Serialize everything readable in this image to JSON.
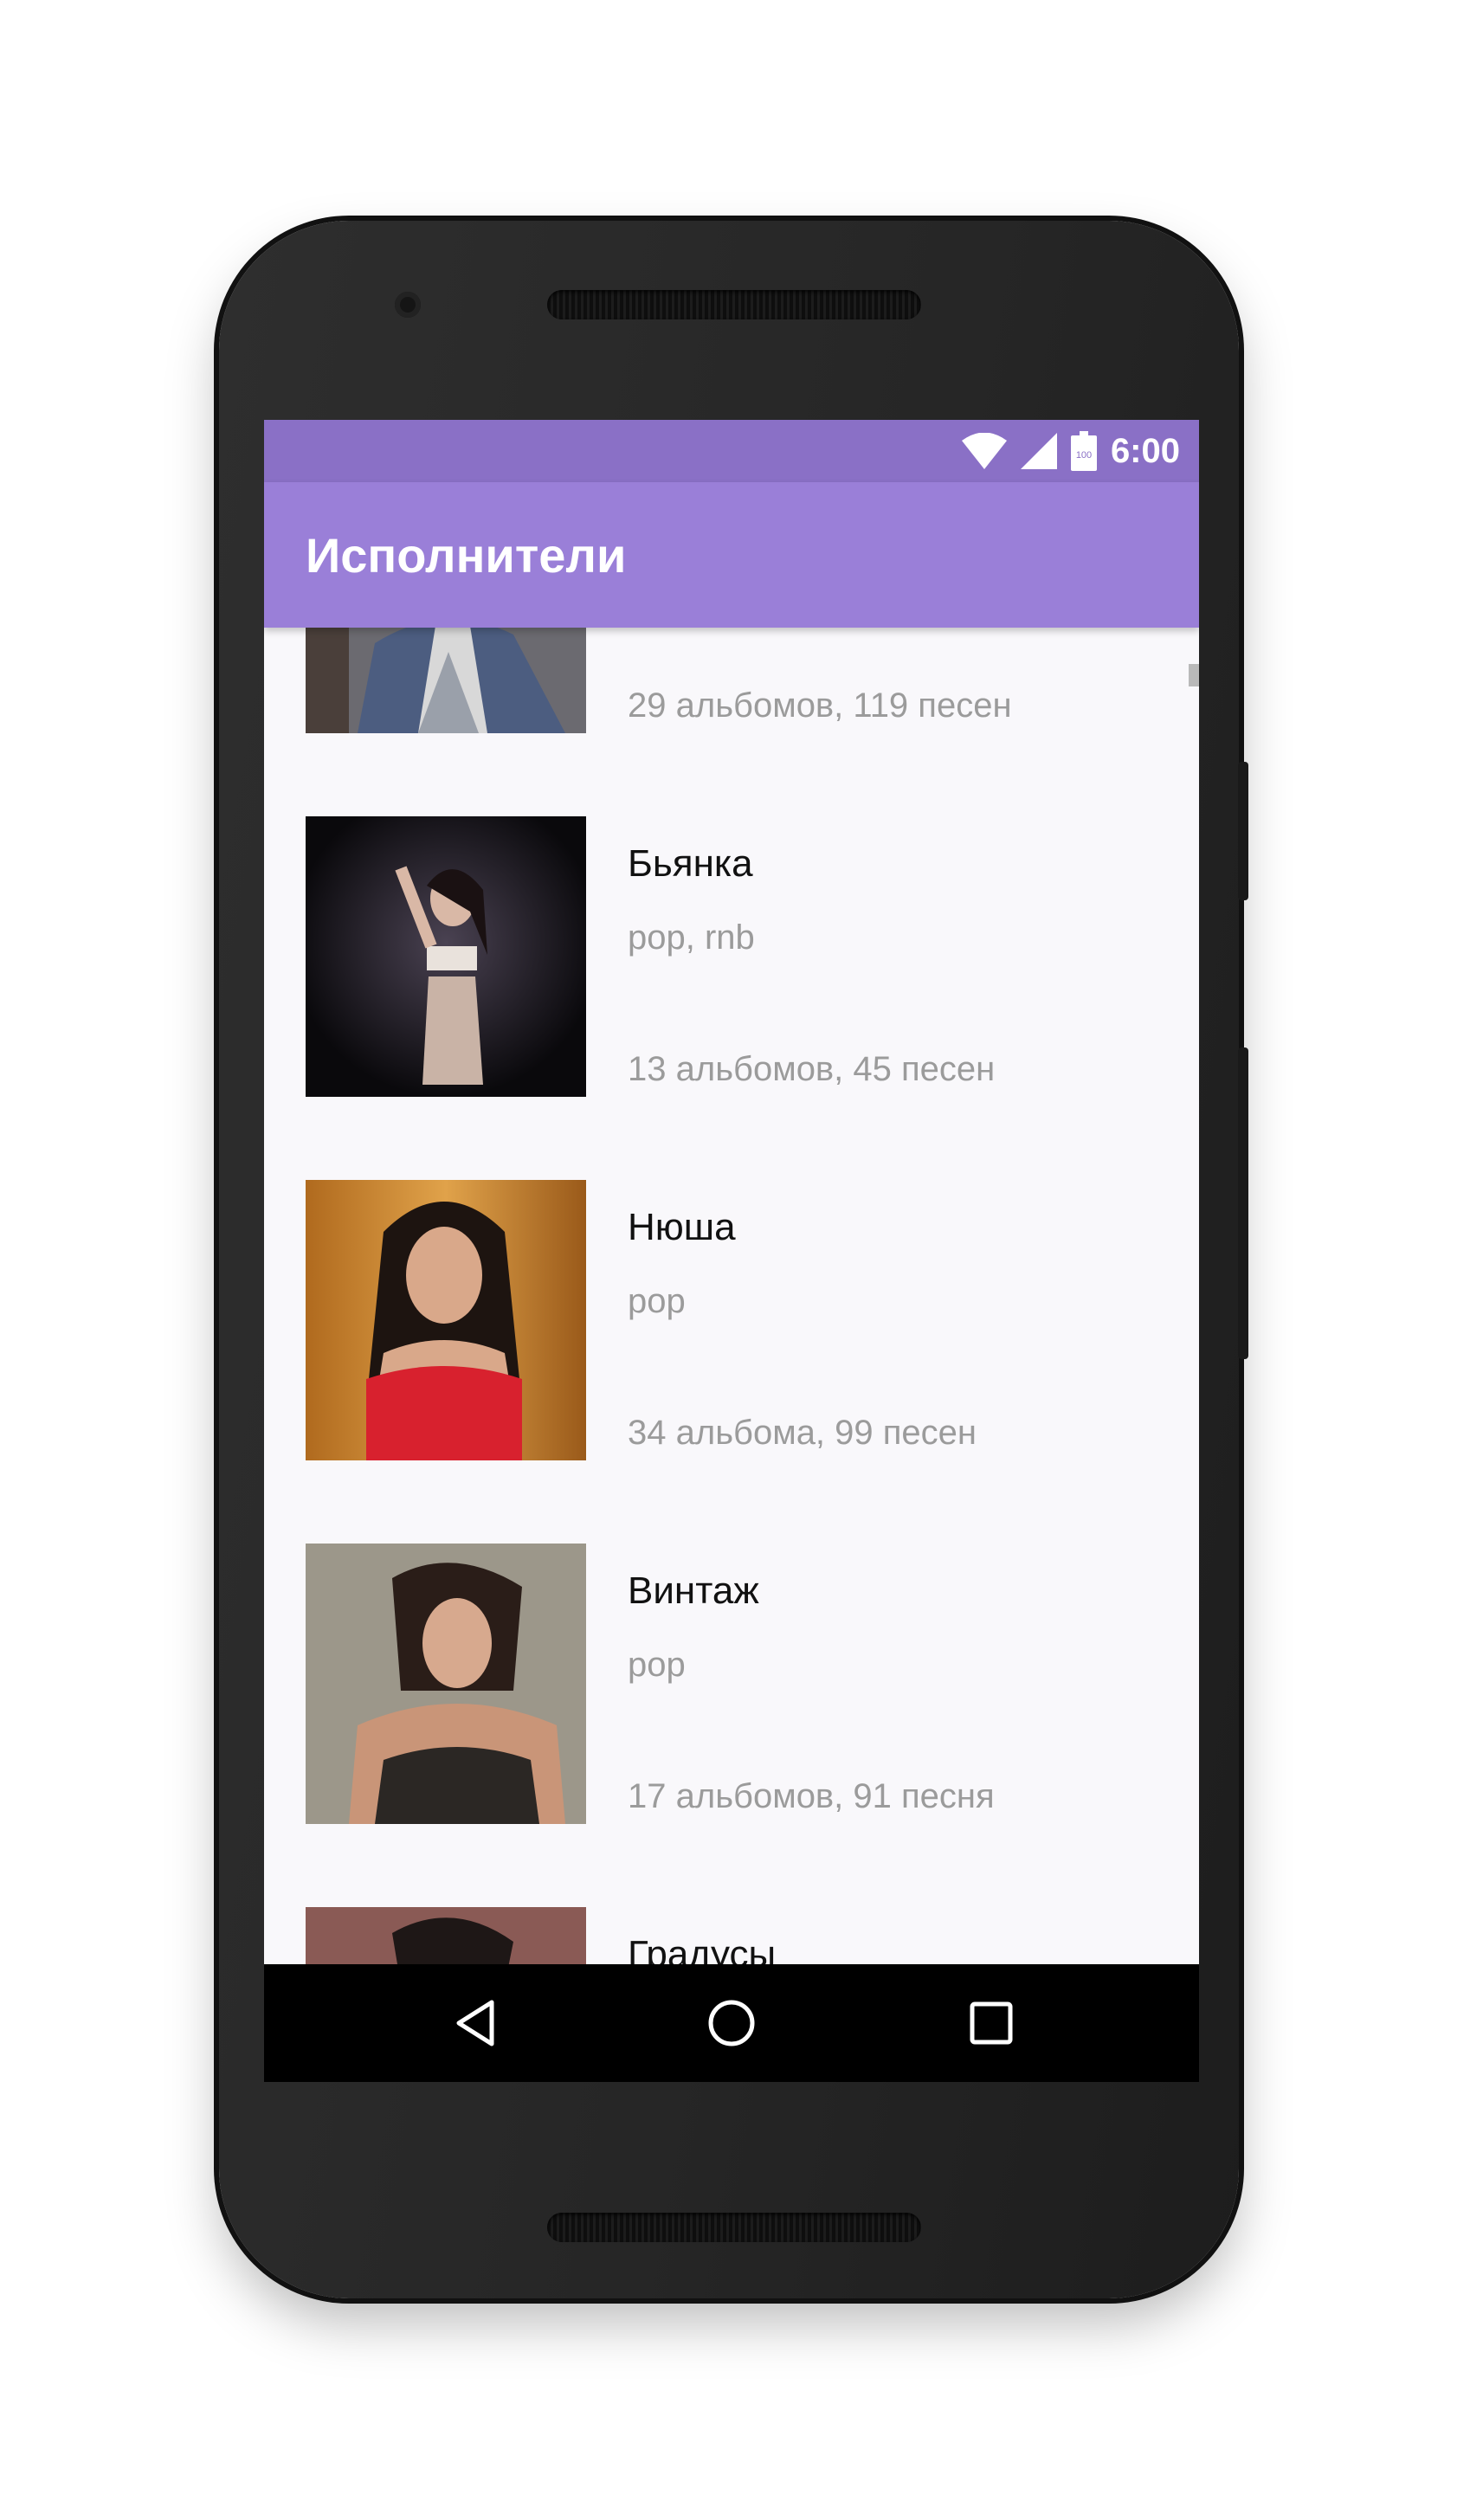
{
  "status_bar": {
    "time": "6:00",
    "battery_level": "100",
    "icons": [
      "wifi-icon",
      "cell-signal-icon",
      "battery-icon"
    ]
  },
  "app_bar": {
    "title": "Исполнители"
  },
  "artists": [
    {
      "name": "",
      "genre": "",
      "stats": "29 альбомов, 119 песен"
    },
    {
      "name": "Бьянка",
      "genre": "pop, rnb",
      "stats": "13 альбомов, 45 песен"
    },
    {
      "name": "Нюша",
      "genre": "pop",
      "stats": "34 альбома, 99 песен"
    },
    {
      "name": "Винтаж",
      "genre": "pop",
      "stats": "17 альбомов, 91 песня"
    },
    {
      "name": "Градусы",
      "genre": "",
      "stats": ""
    }
  ],
  "nav_bar": {
    "buttons": [
      "back-icon",
      "home-icon",
      "recents-icon"
    ]
  },
  "colors": {
    "status_bar": "#8a70c6",
    "app_bar": "#9a7fd8",
    "list_background": "#f9f8fb",
    "secondary_text": "#9b9b9b"
  }
}
